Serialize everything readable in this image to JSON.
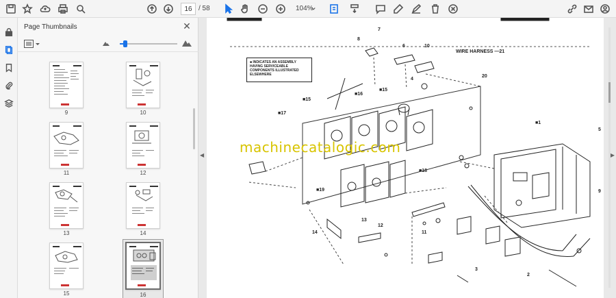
{
  "toolbar": {
    "page_current": "16",
    "page_total": "/ 58",
    "zoom": "104%"
  },
  "panel": {
    "title": "Page Thumbnails"
  },
  "thumbnails": [
    {
      "label": "9"
    },
    {
      "label": "10"
    },
    {
      "label": "11"
    },
    {
      "label": "12"
    },
    {
      "label": "13"
    },
    {
      "label": "14"
    },
    {
      "label": "15"
    },
    {
      "label": "16"
    }
  ],
  "slider": {
    "level": 0.1
  },
  "document": {
    "watermark": "machinecatalogic.com",
    "legend_note": "■ INDICATES AN ASSEMBLY HAVING SERVICEABLE COMPONENTS ILLUSTRATED ELSEWHERE",
    "harness_label": "WIRE HARNESS —21",
    "callouts": [
      "7",
      "8",
      "6",
      "10",
      "4",
      "20",
      "■15",
      "■16",
      "■15",
      "■17",
      "■1",
      "■18",
      "■19",
      "14",
      "13",
      "12",
      "11",
      "3",
      "2",
      "5",
      "9"
    ]
  },
  "colors": {
    "accent": "#1a73e8",
    "watermark": "#d8c400"
  }
}
